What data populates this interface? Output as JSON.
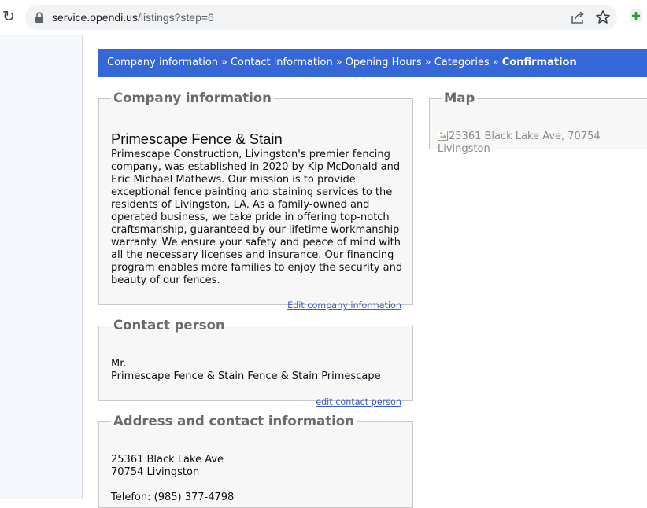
{
  "browser": {
    "url_host": "service.opendi.us",
    "url_path": "/listings?step=6"
  },
  "breadcrumb": {
    "items": [
      "Company information",
      "Contact information",
      "Opening Hours",
      "Categories",
      "Confirmation"
    ],
    "separator": "»"
  },
  "company": {
    "legend": "Company information",
    "name": "Primescape Fence & Stain",
    "description": "Primescape Construction, Livingston's premier fencing company, was established in 2020 by Kip McDonald and Eric Michael Mathews. Our mission is to provide exceptional fence painting and staining services to the residents of Livingston, LA. As a family-owned and operated business, we take pride in offering top-notch craftsmanship, guaranteed by our lifetime workmanship warranty. We ensure your safety and peace of mind with all the necessary licenses and insurance. Our financing program enables more families to enjoy the security and beauty of our fences.",
    "edit_link": "Edit company information"
  },
  "contact": {
    "legend": "Contact person",
    "salutation": "Mr.",
    "name": "Primescape Fence & Stain Fence & Stain Primescape",
    "edit_link": "edit contact person"
  },
  "address": {
    "legend": "Address and contact information",
    "street": "25361 Black Lake Ave",
    "city": "70754 Livingston",
    "phone": "Telefon: (985) 377-4798"
  },
  "map": {
    "legend": "Map",
    "image_alt": "25361 Black Lake Ave, 70754 Livingston"
  },
  "colors": {
    "breadcrumb_bg": "#3567d6",
    "link": "#3a5ccc",
    "legend_text": "#6b6b6b"
  }
}
